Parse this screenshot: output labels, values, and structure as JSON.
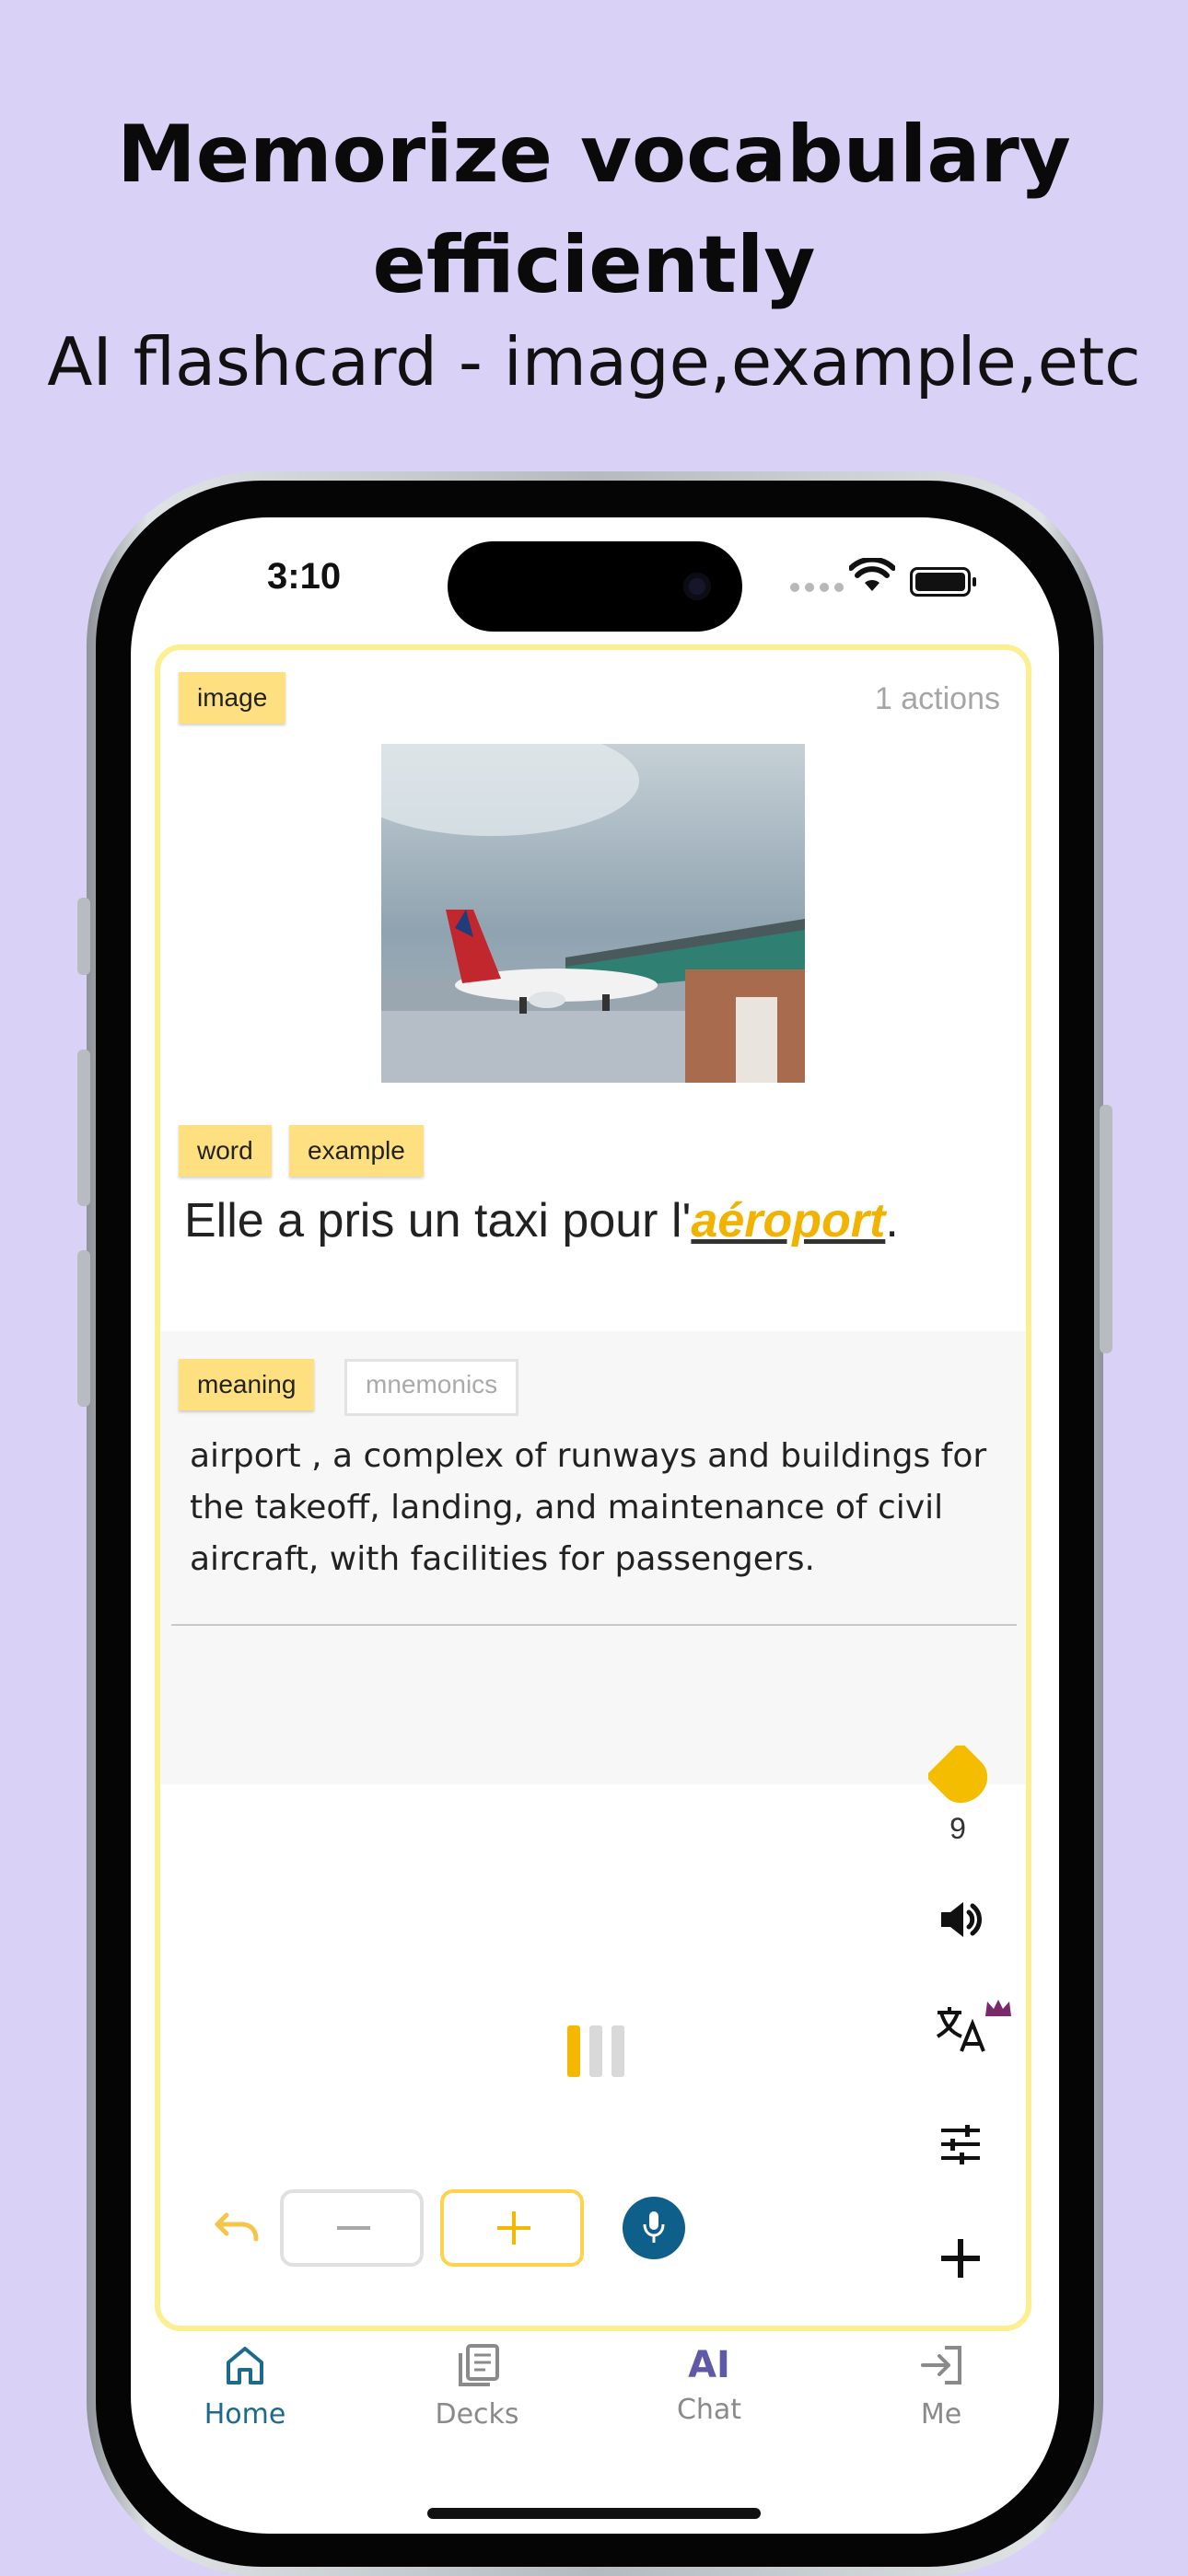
{
  "promo": {
    "headline_line1": "Memorize vocabulary",
    "headline_line2": "efficiently",
    "subhead": "AI flashcard - image,example,etc"
  },
  "status_bar": {
    "time": "3:10"
  },
  "card": {
    "image_tag": "image",
    "actions_count": "1 actions",
    "word_tag": "word",
    "example_tag": "example",
    "sentence_prefix": "Elle a pris un taxi pour l'",
    "sentence_word": "aéroport",
    "sentence_suffix": ".",
    "meaning_tag": "meaning",
    "mnemonics_tag": "mnemonics",
    "meaning_text": "airport , a complex of runways and buildings for the takeoff, landing, and maintenance of civil aircraft, with facilities for passengers."
  },
  "side_tools": {
    "flag_count": "9",
    "icons": [
      "flag-icon",
      "speaker-icon",
      "translate-icon",
      "crown-icon",
      "tune-icon",
      "plus-icon"
    ]
  },
  "controls": {
    "progress_colors": [
      "#f5b800",
      "#d9d9d9",
      "#d9d9d9"
    ]
  },
  "nav": {
    "items": [
      {
        "label": "Home",
        "icon": "home-icon",
        "active": true
      },
      {
        "label": "Decks",
        "icon": "decks-icon",
        "active": false
      },
      {
        "label": "Chat",
        "icon_text": "AI",
        "icon": "ai-icon",
        "active": false
      },
      {
        "label": "Me",
        "icon": "login-icon",
        "active": false
      }
    ]
  },
  "colors": {
    "background": "#d9d2f6",
    "card_border": "#fcef91",
    "tag": "#ffe081",
    "highlight_word": "#f1b200",
    "nav_active": "#1d6a8f",
    "nav_inactive": "#8a8a8a",
    "ai_icon": "#5e5aa8"
  }
}
